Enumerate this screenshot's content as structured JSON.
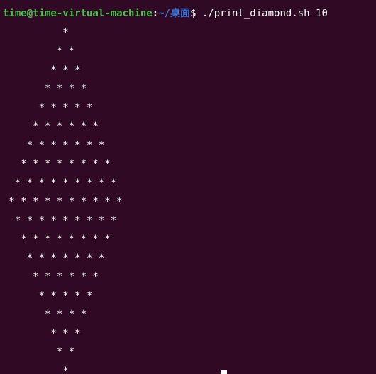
{
  "terminal": {
    "prompt": {
      "user_host": "time@time-virtual-machine",
      "separator": ":",
      "path": "~/桌面",
      "symbol": "$"
    },
    "command": " ./print_diamond.sh 10",
    "output": [
      "          *",
      "         * *",
      "        * * *",
      "       * * * *",
      "      * * * * *",
      "     * * * * * *",
      "    * * * * * * *",
      "   * * * * * * * *",
      "  * * * * * * * * *",
      " * * * * * * * * * *",
      "  * * * * * * * * *",
      "   * * * * * * * *",
      "    * * * * * * *",
      "     * * * * * *",
      "      * * * * *",
      "       * * * *",
      "        * * *",
      "         * *",
      "          *"
    ],
    "colors": {
      "background": "#300a24",
      "user_host": "#4cc04f",
      "path": "#3d78d8",
      "text": "#ffffff"
    }
  }
}
